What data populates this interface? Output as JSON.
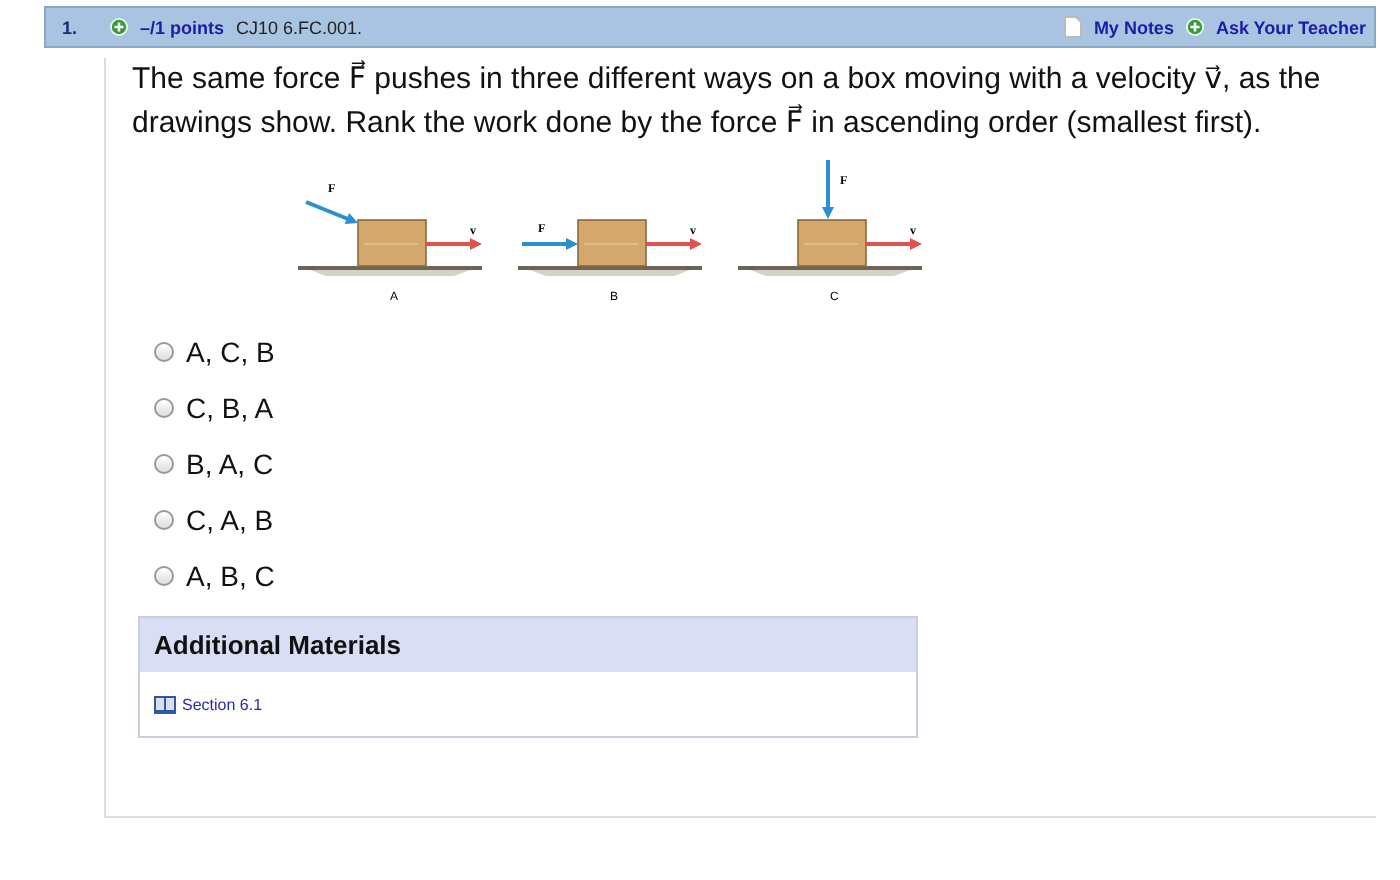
{
  "header": {
    "number": "1.",
    "points": "–/1 points",
    "code": "CJ10 6.FC.001.",
    "links": [
      {
        "label": "My Notes",
        "kind": "notes"
      },
      {
        "label": "Ask Your Teacher",
        "kind": "ask"
      }
    ]
  },
  "question": "The same force F⃗ pushes in three different ways on a box moving with a velocity v⃗, as the drawings show. Rank the work done by the force F⃗ in ascending order (smallest first).",
  "figure": {
    "panels": [
      {
        "label": "A",
        "kind": "angled",
        "force_label": "F⃗",
        "velocity_label": "v⃗"
      },
      {
        "label": "B",
        "kind": "horizontal",
        "force_label": "F⃗",
        "velocity_label": "v⃗"
      },
      {
        "label": "C",
        "kind": "vertical",
        "force_label": "F⃗",
        "velocity_label": "v⃗"
      }
    ]
  },
  "options": [
    {
      "label": "A, C, B",
      "selected": false
    },
    {
      "label": "C, B, A",
      "selected": false
    },
    {
      "label": "B, A, C",
      "selected": false
    },
    {
      "label": "C, A, B",
      "selected": false
    },
    {
      "label": "A, B, C",
      "selected": false
    }
  ],
  "additional_materials": {
    "title": "Additional Materials",
    "links": [
      {
        "label": "Section 6.1"
      }
    ]
  }
}
